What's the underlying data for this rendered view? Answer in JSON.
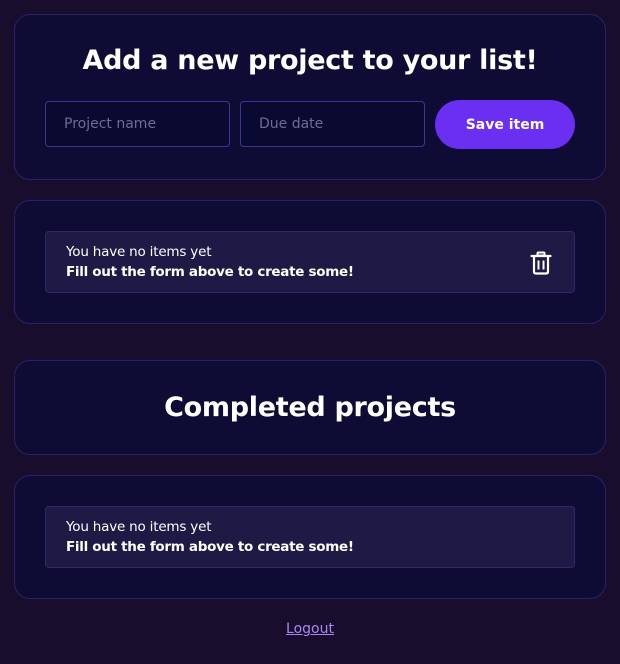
{
  "form": {
    "title": "Add a new project to your list!",
    "name_placeholder": "Project name",
    "name_value": "",
    "date_placeholder": "Due date",
    "date_value": "",
    "save_label": "Save item"
  },
  "pending": {
    "empty_line1": "You have no items yet",
    "empty_line2": "Fill out the form above to create some!",
    "action_icon": "trash-icon"
  },
  "completed": {
    "title": "Completed projects",
    "empty_line1": "You have no items yet",
    "empty_line2": "Fill out the form above to create some!"
  },
  "footer": {
    "logout_label": "Logout"
  },
  "colors": {
    "background": "#180d2c",
    "card": "#0e0c35",
    "accent": "#6a2ff0",
    "link": "#a986f5"
  }
}
